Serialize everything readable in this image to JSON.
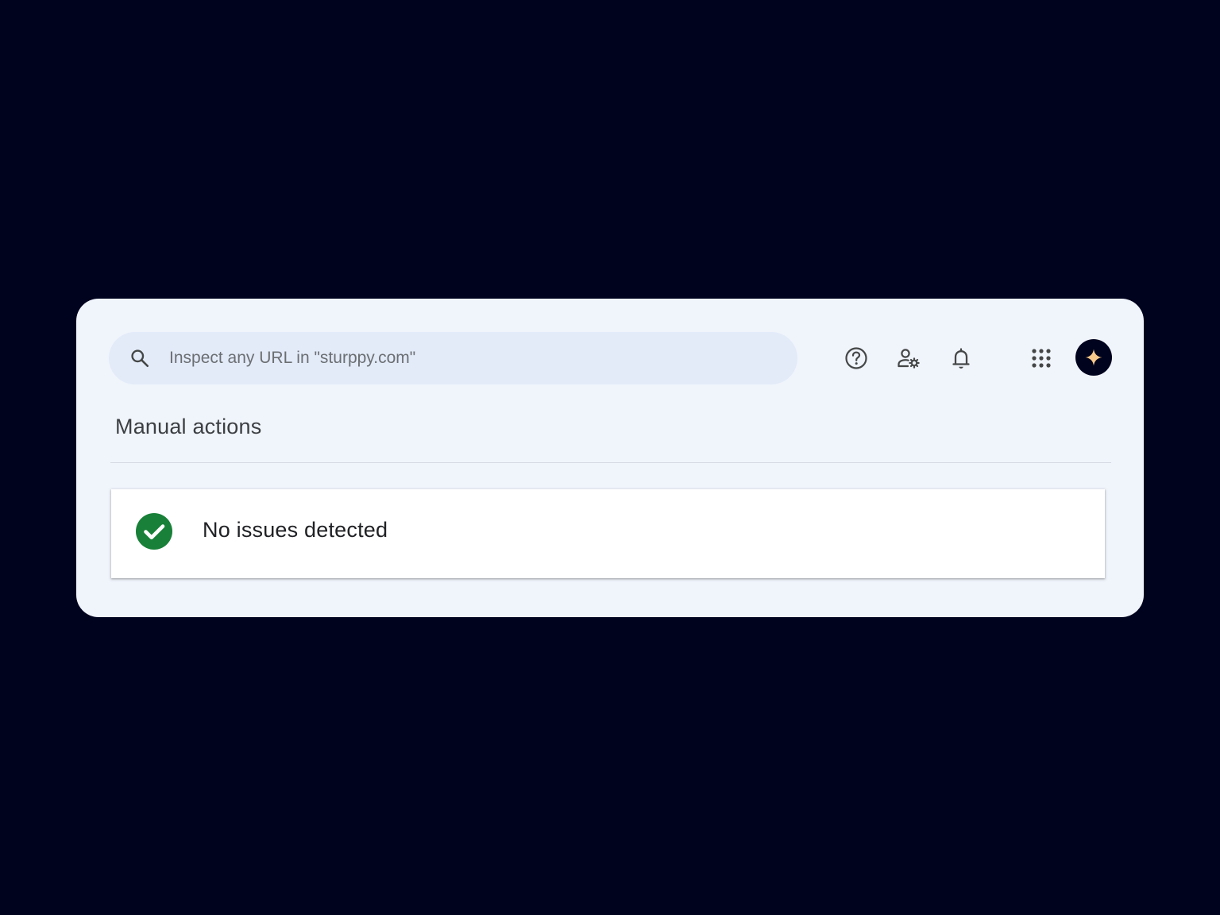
{
  "search": {
    "placeholder": "Inspect any URL in \"sturppy.com\"",
    "icon": "search-icon"
  },
  "toolbar": {
    "icons": [
      "help-icon",
      "user-settings-icon",
      "bell-icon",
      "apps-grid-icon"
    ],
    "avatar_icon": "sparkle-icon",
    "avatar_accent": "#f7c98b"
  },
  "page": {
    "title": "Manual actions"
  },
  "status": {
    "text": "No issues detected",
    "icon": "check-circle-icon",
    "color": "#188038"
  },
  "colors": {
    "background": "#00031e",
    "panel": "#f0f4fb",
    "search_bar": "#e3ebf9"
  }
}
